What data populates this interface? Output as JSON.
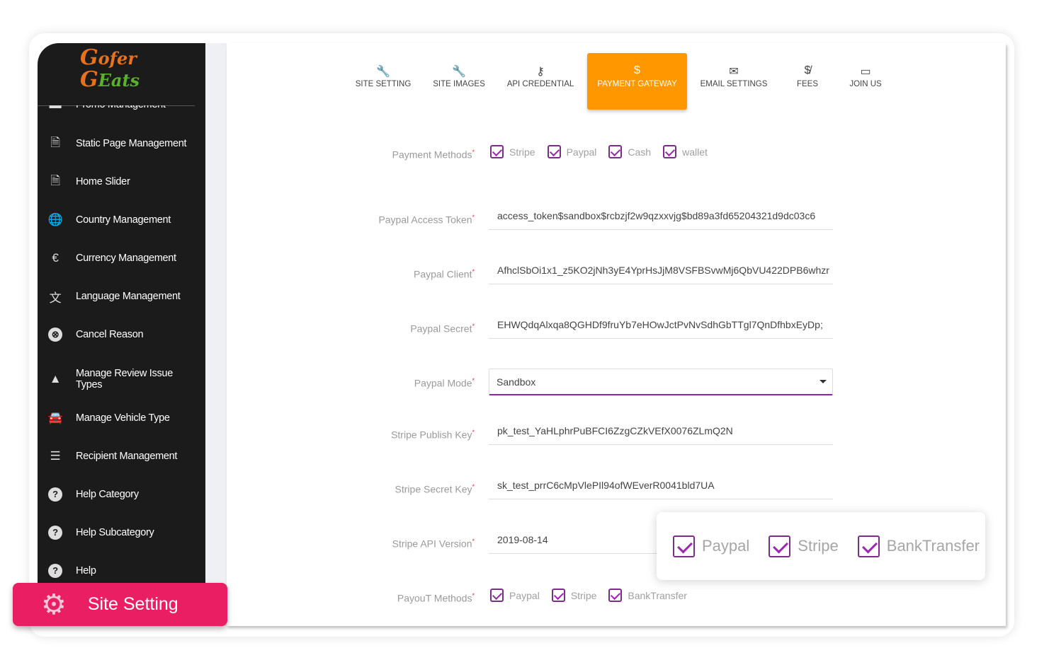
{
  "brand": {
    "logo_text": "Gofer Eats"
  },
  "sidebar": {
    "items": [
      {
        "label": "Promo Management",
        "icon": "promo-icon"
      },
      {
        "label": "Static Page Management",
        "icon": "file-icon"
      },
      {
        "label": "Home Slider",
        "icon": "file-icon"
      },
      {
        "label": "Country Management",
        "icon": "globe-icon"
      },
      {
        "label": "Currency Management",
        "icon": "euro-icon"
      },
      {
        "label": "Language Management",
        "icon": "translate-icon"
      },
      {
        "label": "Cancel Reason",
        "icon": "cancel-icon"
      },
      {
        "label": "Manage Review Issue Types",
        "icon": "warning-icon"
      },
      {
        "label": "Manage Vehicle Type",
        "icon": "car-icon"
      },
      {
        "label": "Recipient Management",
        "icon": "list-icon"
      },
      {
        "label": "Help Category",
        "icon": "help-icon"
      },
      {
        "label": "Help Subcategory",
        "icon": "help-icon"
      },
      {
        "label": "Help",
        "icon": "help-icon"
      }
    ]
  },
  "site_setting_button": {
    "label": "Site Setting",
    "icon": "gear-icon"
  },
  "tabs": [
    {
      "label": "SITE SETTING",
      "icon": "wrench-icon"
    },
    {
      "label": "SITE IMAGES",
      "icon": "wrench-icon"
    },
    {
      "label": "API CREDENTIAL",
      "icon": "key-icon"
    },
    {
      "label": "PAYMENT GATEWAY",
      "icon": "dollar-icon",
      "active": true
    },
    {
      "label": "EMAIL SETTINGS",
      "icon": "envelope-icon"
    },
    {
      "label": "FEES",
      "icon": "money-off-icon"
    },
    {
      "label": "JOIN US",
      "icon": "devices-icon"
    }
  ],
  "accent_color": "#ff9800",
  "checkbox_color": "#9c27b0",
  "form": {
    "payment_methods": {
      "label": "Payment Methods",
      "options": [
        "Stripe",
        "Paypal",
        "Cash",
        "wallet"
      ]
    },
    "paypal_access_token": {
      "label": "Paypal Access Token",
      "value": "access_token$sandbox$rcbzjf2w9qzxxvjg$bd89a3fd65204321d9dc03c6"
    },
    "paypal_client": {
      "label": "Paypal Client",
      "value": "AfhclSbOi1x1_z5KO2jNh3yE4YprHsJjM8VSFBSvwMj6QbVU422DPB6whzr"
    },
    "paypal_secret": {
      "label": "Paypal Secret",
      "value": "EHWQdqAlxqa8QGHDf9fruYb7eHOwJctPvNvSdhGbTTgl7QnDfhbxEyDp;"
    },
    "paypal_mode": {
      "label": "Paypal Mode",
      "value": "Sandbox"
    },
    "stripe_publish_key": {
      "label": "Stripe Publish Key",
      "value": "pk_test_YaHLphrPuBFCI6ZzgCZkVEfX0076ZLmQ2N"
    },
    "stripe_secret_key": {
      "label": "Stripe Secret Key",
      "value": "sk_test_prrC6cMpVlePIl94ofWEverR0041bld7UA"
    },
    "stripe_api_version": {
      "label": "Stripe API Version",
      "value": "2019-08-14"
    },
    "payout_methods": {
      "label": "PayouT Methods",
      "options": [
        "Paypal",
        "Stripe",
        "BankTransfer"
      ]
    }
  },
  "popup": {
    "options": [
      "Paypal",
      "Stripe",
      "BankTransfer"
    ]
  }
}
